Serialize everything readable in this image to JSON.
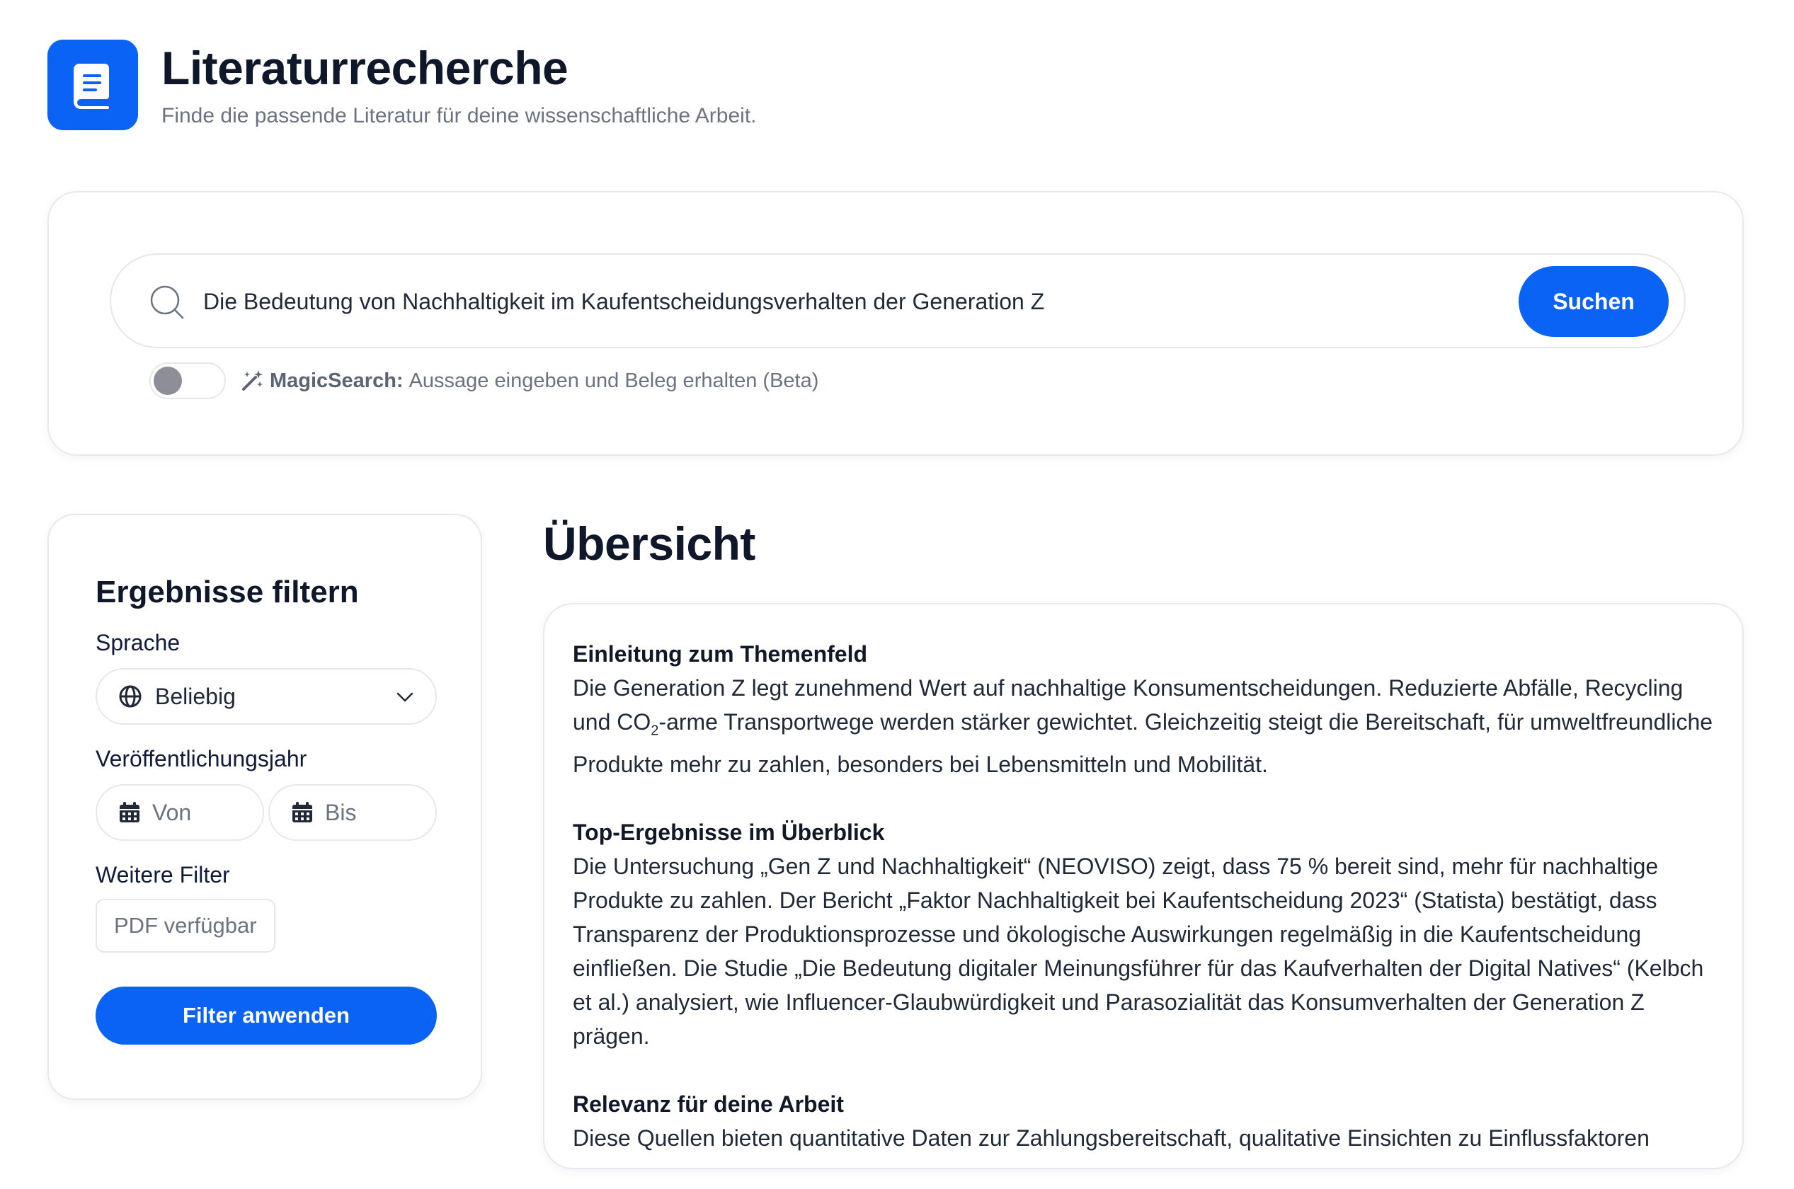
{
  "header": {
    "title": "Literaturrecherche",
    "subtitle": "Finde die passende Literatur für deine wissenschaftliche Arbeit."
  },
  "search": {
    "query": "Die Bedeutung von Nachhaltigkeit im Kaufentscheidungsverhalten der Generation Z",
    "button_label": "Suchen",
    "magic_label": "MagicSearch:",
    "magic_text": "Aussage eingeben und Beleg erhalten (Beta)",
    "magic_enabled": false
  },
  "filters": {
    "title": "Ergebnisse filtern",
    "language_label": "Sprache",
    "language_value": "Beliebig",
    "year_label": "Veröffentlichungsjahr",
    "year_from_placeholder": "Von",
    "year_to_placeholder": "Bis",
    "more_label": "Weitere Filter",
    "pdf_chip": "PDF verfügbar",
    "apply_label": "Filter anwenden"
  },
  "overview": {
    "title": "Übersicht",
    "sections": [
      {
        "heading": "Einleitung zum Themenfeld",
        "body_part1": "Die Generation Z legt zunehmend Wert auf nachhaltige Konsumentscheidungen. Reduzierte Abfälle, Recycling und CO",
        "subscript": "2",
        "body_part2": "-arme Transportwege werden stärker gewichtet. Gleichzeitig steigt die Bereitschaft, für umweltfreundliche Produkte mehr zu zahlen, besonders bei Lebensmitteln und Mobilität."
      },
      {
        "heading": "Top-Ergebnisse im Überblick",
        "body": "Die Untersuchung „Gen Z und Nachhaltigkeit“ (NEOVISO) zeigt, dass 75 % bereit sind, mehr für nachhaltige Produkte zu zahlen. Der Bericht „Faktor Nachhaltigkeit bei Kaufentscheidung 2023“ (Statista) bestätigt, dass Transparenz der Produktionsprozesse und ökologische Auswirkungen regelmäßig in die Kaufentscheidung einfließen. Die Studie „Die Bedeutung digitaler Meinungsführer für das Kaufverhalten der Digital Natives“ (Kelbch et al.) analysiert, wie Influencer-Glaubwürdigkeit und Parasozialität das Konsumverhalten der Generation Z prägen."
      },
      {
        "heading": "Relevanz für deine Arbeit",
        "body": "Diese Quellen bieten quantitative Daten zur Zahlungsbereitschaft, qualitative Einsichten zu Einflussfaktoren"
      }
    ]
  },
  "colors": {
    "accent": "#0b63f6",
    "border": "#e5e7eb",
    "muted_text": "#6b7280",
    "toggle_knob": "#8e8e98"
  }
}
